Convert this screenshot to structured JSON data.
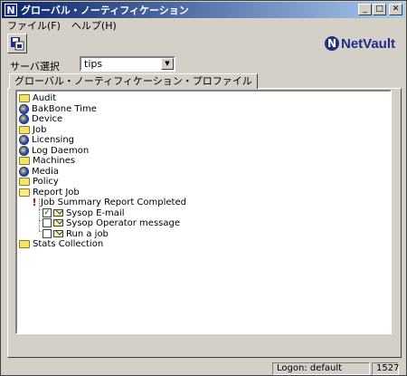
{
  "window": {
    "title": "グローバル・ノーティフィケーション"
  },
  "menu": {
    "file": "ファイル(F)",
    "help": "ヘルプ(H)"
  },
  "logo": {
    "text": "NetVault"
  },
  "server": {
    "label": "サーバ選択",
    "value": "tips"
  },
  "tab": {
    "label": "グローバル・ノーティフィケーション・プロファイル"
  },
  "tree": {
    "items": [
      {
        "label": "Audit",
        "icon": "folder-icon"
      },
      {
        "label": "BakBone Time",
        "icon": "globe-icon"
      },
      {
        "label": "Device",
        "icon": "globe-icon"
      },
      {
        "label": "Job",
        "icon": "folder-icon"
      },
      {
        "label": "Licensing",
        "icon": "globe-icon"
      },
      {
        "label": "Log Daemon",
        "icon": "globe-icon"
      },
      {
        "label": "Machines",
        "icon": "folder-icon"
      },
      {
        "label": "Media",
        "icon": "globe-icon"
      },
      {
        "label": "Policy",
        "icon": "folder-icon"
      },
      {
        "label": "Report Job",
        "icon": "folder-open-icon"
      },
      {
        "label": "Job Summary Report Completed",
        "icon": "exclamation-icon"
      },
      {
        "label": "Sysop E-mail",
        "icon": "mail-icon",
        "checked": true
      },
      {
        "label": "Sysop Operator message",
        "icon": "mail-icon",
        "checked": false
      },
      {
        "label": "Run a job",
        "icon": "mail-icon",
        "checked": false
      },
      {
        "label": "Stats Collection",
        "icon": "folder-icon"
      }
    ]
  },
  "status": {
    "logon": "Logon: default",
    "number": "1527"
  }
}
